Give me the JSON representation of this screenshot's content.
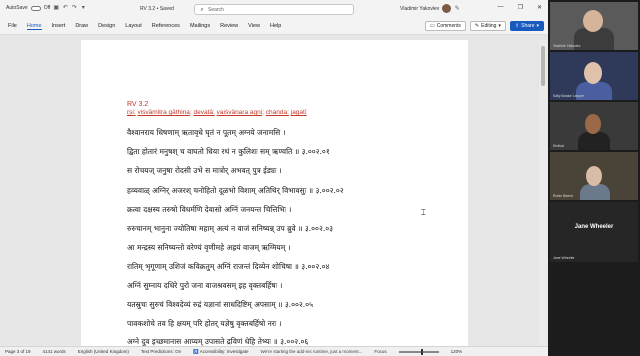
{
  "titlebar": {
    "autosave_label": "AutoSave",
    "autosave_state": "Off",
    "document_name": "RV 3.2 • Saved",
    "search_placeholder": "Search",
    "user_name": "Vladimir Yakovlev"
  },
  "menu": {
    "tabs": [
      "File",
      "Home",
      "Insert",
      "Draw",
      "Design",
      "Layout",
      "References",
      "Mailings",
      "Review",
      "View",
      "Help"
    ]
  },
  "ribbon_right": {
    "comments_label": "Comments",
    "editing_label": "Editing",
    "share_label": "Share"
  },
  "document": {
    "heading": "RV 3.2",
    "meta": {
      "rsi_label": "ṛṣi:",
      "rsi": "viśvāmitra gāthina",
      "devata_label": "devatā:",
      "devata": "vaiśvānara agni",
      "chanda_label": "chanda:",
      "chanda": "jagatī"
    },
    "verses": [
      "वैश्वानराय धिषणाम् ऋतावृधे घृतं न पूतम् अग्नये जनामसि ।",
      "द्विता होतारं मनुषश् च वाघतो धिया रथं न कुलिशः सम् ऋण्वति ॥ ३.००२.०१",
      "स रोचयज् जनुषा रोदसी उभे स मात्रोर् अभवत् पुत्र ईड्यः ।",
      "हव्यवाळ् अग्निर् अजरश् चनोहितो दूळभो विशाम् अतिथिर् विभावसुः ॥ ३.००२.०२",
      "क्रत्वा दक्षस्य तरुषो विधर्मणि देवासो अग्निं जनयन्त चित्तिभिः ।",
      "रुरुचानम् भानुना ज्योतिषा महाम् अत्यं न वाजं सनिष्यन्न् उप ब्रुवे ॥ ३.००२.०३",
      "आ मन्द्रस्य सनिष्यन्तो वरेण्यं वृणीमहे अह्रयं वाजम् ऋग्मियम् ।",
      "रातिम् भृगूणाम् उशिजं कविक्रतुम् अग्निं राजन्तं दिव्येन शोचिषा ॥ ३.००२.०४",
      "अग्निं सुम्नाय दधिरे पुरो जना वाजश्रवसम् इह वृक्तबर्हिषः ।",
      "यतस्रुचः सुरुचं विश्वदेव्यं रुद्रं यज्ञानां साधदिष्टिम् अपसाम् ॥ ३.००२.०५",
      "पावकशोचे तव हि क्षयम् परि होतर् यज्ञेषु वृक्तबर्हिषो नरः ।",
      "अग्ने दुव इच्छमानास आप्यम् उपासते द्रविणं धेहि तेभ्यः ॥ ३.००२.०६"
    ]
  },
  "statusbar": {
    "page": "Page 3 of 19",
    "words": "4141 words",
    "language": "English (United Kingdom)",
    "text_predictions": "Text Predictions: On",
    "accessibility": "Accessibility: Investigate",
    "banner": "We're starting the add-ins runtime, just a moment...",
    "focus": "Focus",
    "zoom": "120%"
  },
  "participants": [
    {
      "name": "Vladimir Yakovlev"
    },
    {
      "name": "Sally Bostor Lawyer"
    },
    {
      "name": "Kinthal"
    },
    {
      "name": "Robin Beech"
    },
    {
      "name": "Jane Wheeler"
    }
  ],
  "colors": {
    "accent": "#185abd",
    "metadata_red": "#c0392b"
  }
}
